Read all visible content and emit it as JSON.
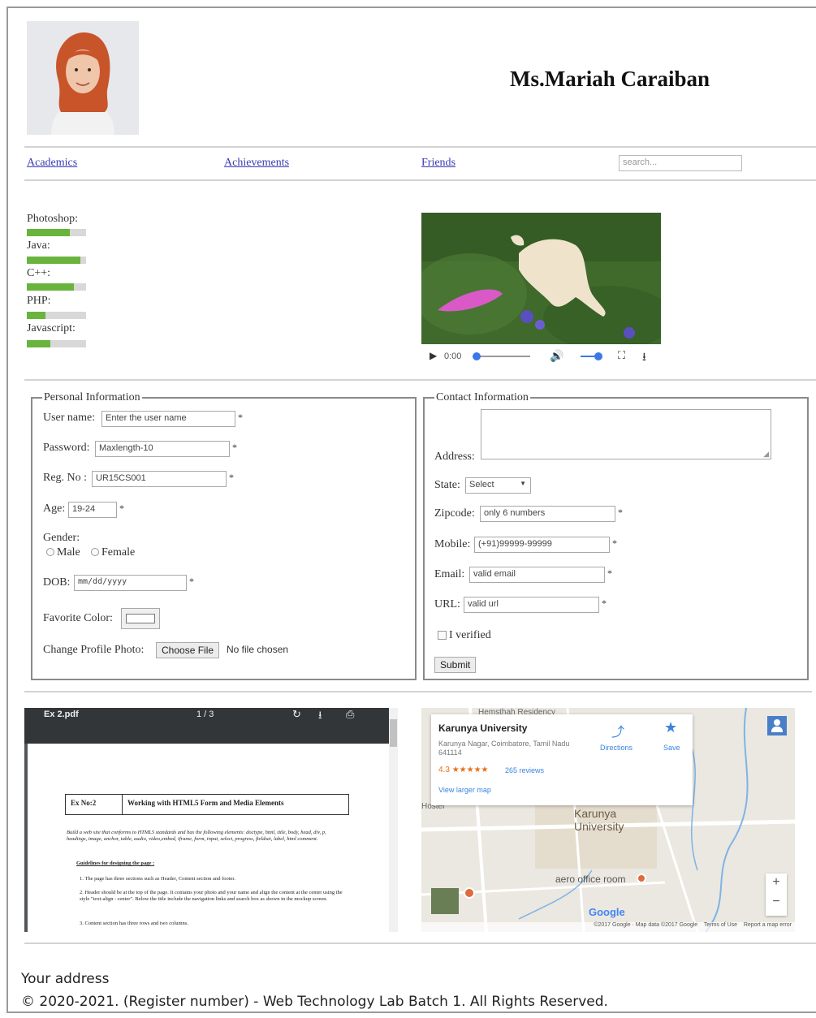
{
  "header": {
    "name": "Ms.Mariah Caraiban"
  },
  "nav": {
    "items": [
      "Academics",
      "Achievements",
      "Friends"
    ],
    "search_placeholder": "search..."
  },
  "skills": [
    {
      "label": "Photoshop:",
      "level": 0.72
    },
    {
      "label": "Java:",
      "level": 0.9
    },
    {
      "label": "C++:",
      "level": 0.8
    },
    {
      "label": "PHP:",
      "level": 0.32
    },
    {
      "label": "Javascript:",
      "level": 0.4
    }
  ],
  "video": {
    "time": "0:00"
  },
  "personal": {
    "legend": "Personal Information",
    "username_label": "User name:",
    "username_value": "Enter the user name",
    "password_label": "Password:",
    "password_value": "Maxlength-10",
    "regno_label": "Reg. No :",
    "regno_value": "UR15CS001",
    "age_label": "Age:",
    "age_value": "19-24",
    "gender_label": "Gender:",
    "gender_male": "Male",
    "gender_female": "Female",
    "dob_label": "DOB:",
    "dob_value": "mm/dd/yyyy",
    "color_label": "Favorite Color:",
    "photo_label": "Change Profile Photo:",
    "choose_file": "Choose File",
    "no_file": "No file chosen",
    "required": "*"
  },
  "contact": {
    "legend": "Contact Information",
    "address_label": "Address:",
    "state_label": "State:",
    "state_value": "Select",
    "zip_label": "Zipcode:",
    "zip_value": "only 6 numbers",
    "mobile_label": "Mobile:",
    "mobile_value": "(+91)99999-99999",
    "email_label": "Email:",
    "email_value": "valid email",
    "url_label": "URL:",
    "url_value": "valid url",
    "verified_label": "I verified",
    "submit": "Submit"
  },
  "pdf": {
    "filename": "Ex 2.pdf",
    "page": "1 / 3",
    "ex_no": "Ex No:2",
    "ex_title": "Working with HTML5 Form and Media Elements",
    "intro": "Build a web site that conforms to HTML5 standards and has the following elements: doctype, html, title, body, head, div, p, headings, image, anchor, table, audio, video,embed, iframe, form, input, select, progress, fieldset, label, html comment.",
    "guidelines": "Guidelines for designing the page :",
    "item1": "1.  The page has three sections such as Header, Content section and footer.",
    "item2": "2.  Header should be at the top of the page. It contains your photo and your name and align the content at the center using the style \"text-align : center\". Below the title include the navigation links and search box as shown in the mockup screen.",
    "item3": "3.  Content section has three rows and two columns."
  },
  "map": {
    "place_name": "Karunya University",
    "place_address": "Karunya Nagar, Coimbatore, Tamil Nadu 641114",
    "rating": "4.3",
    "stars": "★★★★★",
    "reviews": "265 reviews",
    "larger_map": "View larger map",
    "directions": "Directions",
    "save": "Save",
    "label_top": "Hemsthah Residency",
    "label_hostel": "Hostel",
    "label_university": "Karunya University",
    "label_aero": "aero office room",
    "google_logo": "Google",
    "footer_text": "©2017 Google · Map data ©2017 Google    Terms of Use    Report a map error"
  },
  "footer": {
    "address": "Your address",
    "copyright": "© 2020-2021. (Register number) - Web Technology Lab Batch 1. All Rights Reserved."
  }
}
